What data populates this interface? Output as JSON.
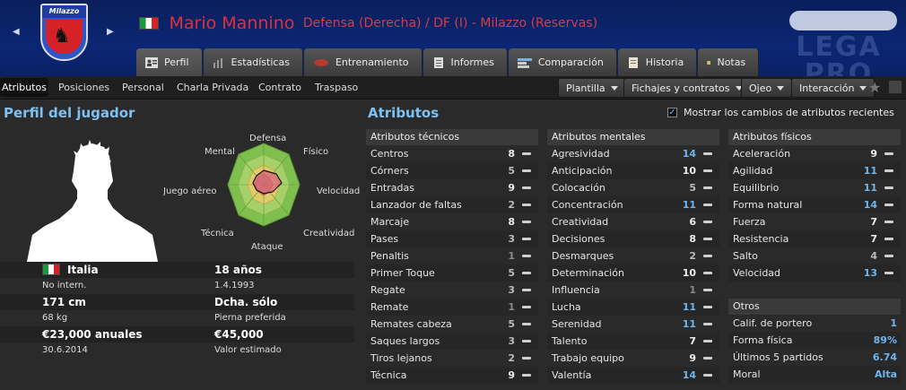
{
  "header": {
    "club_crest_text": "Milazzo",
    "player_name": "Mario Mannino",
    "position_club": "Defensa (Derecha) / DF (I) - Milazzo (Reservas)",
    "league_watermark": "LEGA PRO"
  },
  "tabs": [
    {
      "label": "Perfil",
      "icon": "profile-icon"
    },
    {
      "label": "Estadísticas",
      "icon": "stats-icon"
    },
    {
      "label": "Entrenamiento",
      "icon": "training-icon"
    },
    {
      "label": "Informes",
      "icon": "report-icon"
    },
    {
      "label": "Comparación",
      "icon": "compare-icon"
    },
    {
      "label": "Historia",
      "icon": "history-icon"
    },
    {
      "label": "Notas",
      "icon": "notes-icon"
    }
  ],
  "subnav": [
    "Atributos",
    "Posiciones",
    "Personal",
    "Charla Privada",
    "Contrato",
    "Traspaso"
  ],
  "toolbar": {
    "plantilla": "Plantilla",
    "fichajes": "Fichajes y contratos",
    "ojeo": "Ojeo",
    "interaccion": "Interacción"
  },
  "profile": {
    "title": "Perfil del jugador",
    "nationality": "Italia",
    "caps": "No intern.",
    "height": "171 cm",
    "weight": "68 kg",
    "wage": "€23,000 anuales",
    "contract_end": "30.6.2014",
    "age": "18 años",
    "birthdate": "1.4.1993",
    "foot": "Dcha. sólo",
    "foot_label": "Pierna preferida",
    "value": "€45,000",
    "value_label": "Valor estimado"
  },
  "radar": {
    "labels": [
      "Defensa",
      "Físico",
      "Velocidad",
      "Creatividad",
      "Ataque",
      "Técnica",
      "Juego aéreo",
      "Mental"
    ]
  },
  "attributes": {
    "title": "Atributos",
    "show_changes": "Mostrar los cambios de atributos recientes",
    "technical_header": "Atributos técnicos",
    "mental_header": "Atributos mentales",
    "physical_header": "Atributos físicos",
    "technical": [
      {
        "name": "Centros",
        "value": "8"
      },
      {
        "name": "Córners",
        "value": "5"
      },
      {
        "name": "Entradas",
        "value": "9"
      },
      {
        "name": "Lanzador de faltas",
        "value": "2"
      },
      {
        "name": "Marcaje",
        "value": "8"
      },
      {
        "name": "Pases",
        "value": "3"
      },
      {
        "name": "Penaltis",
        "value": "1"
      },
      {
        "name": "Primer Toque",
        "value": "5"
      },
      {
        "name": "Regate",
        "value": "3"
      },
      {
        "name": "Remate",
        "value": "1"
      },
      {
        "name": "Remates cabeza",
        "value": "5"
      },
      {
        "name": "Saques largos",
        "value": "3"
      },
      {
        "name": "Tiros lejanos",
        "value": "2"
      },
      {
        "name": "Técnica",
        "value": "9"
      }
    ],
    "mental": [
      {
        "name": "Agresividad",
        "value": "14"
      },
      {
        "name": "Anticipación",
        "value": "10"
      },
      {
        "name": "Colocación",
        "value": "5"
      },
      {
        "name": "Concentración",
        "value": "11"
      },
      {
        "name": "Creatividad",
        "value": "6"
      },
      {
        "name": "Decisiones",
        "value": "8"
      },
      {
        "name": "Desmarques",
        "value": "2"
      },
      {
        "name": "Determinación",
        "value": "10"
      },
      {
        "name": "Influencia",
        "value": "1"
      },
      {
        "name": "Lucha",
        "value": "11"
      },
      {
        "name": "Serenidad",
        "value": "11"
      },
      {
        "name": "Talento",
        "value": "7"
      },
      {
        "name": "Trabajo equipo",
        "value": "9"
      },
      {
        "name": "Valentía",
        "value": "14"
      }
    ],
    "physical": [
      {
        "name": "Aceleración",
        "value": "9"
      },
      {
        "name": "Agilidad",
        "value": "11"
      },
      {
        "name": "Equilibrio",
        "value": "11"
      },
      {
        "name": "Forma natural",
        "value": "14"
      },
      {
        "name": "Fuerza",
        "value": "7"
      },
      {
        "name": "Resistencia",
        "value": "7"
      },
      {
        "name": "Salto",
        "value": "4"
      },
      {
        "name": "Velocidad",
        "value": "13"
      }
    ]
  },
  "otros": {
    "header": "Otros",
    "rows": [
      {
        "name": "Calif. de portero",
        "value": "1"
      },
      {
        "name": "Forma física",
        "value": "89%"
      },
      {
        "name": "Últimos 5 partidos",
        "value": "6.74"
      },
      {
        "name": "Moral",
        "value": "Alta"
      }
    ]
  },
  "colors": {
    "name_red": "#e0303c",
    "accent_blue": "#6fb6ef",
    "header_bg": "#0b2673"
  }
}
